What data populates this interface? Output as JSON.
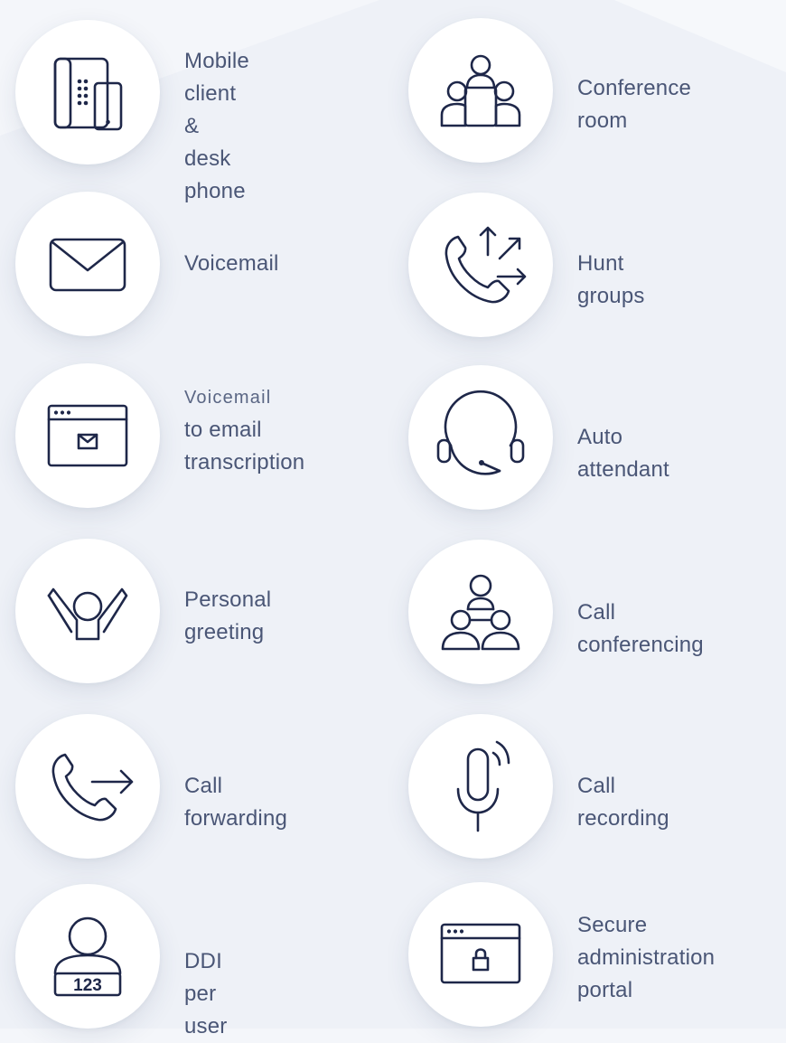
{
  "features": {
    "mobile_client": {
      "line1": "Mobile client",
      "line2": "& desk phone",
      "icon": "desk-phone-mobile-icon"
    },
    "conference_room": {
      "line1": "Conference room",
      "icon": "conference-room-icon"
    },
    "voicemail": {
      "line1": "Voicemail",
      "icon": "envelope-icon"
    },
    "hunt_groups": {
      "line1": "Hunt groups",
      "icon": "phone-arrows-icon"
    },
    "voicemail_email": {
      "line1": "Voicemail",
      "line2": "to email",
      "line3": "transcription",
      "icon": "browser-envelope-icon"
    },
    "auto_attendant": {
      "line1": "Auto attendant",
      "icon": "headset-icon"
    },
    "personal_greeting": {
      "line1": "Personal",
      "line2": "greeting",
      "icon": "person-waving-icon"
    },
    "call_conferencing": {
      "line1": "Call conferencing",
      "icon": "connected-people-icon"
    },
    "call_forwarding": {
      "line1": "Call forwarding",
      "icon": "phone-forward-icon"
    },
    "call_recording": {
      "line1": "Call recording",
      "icon": "microphone-icon"
    },
    "ddi_per_user": {
      "line1": "DDI per user",
      "badge": "123",
      "icon": "user-number-icon"
    },
    "secure_portal": {
      "line1": "Secure",
      "line2": "administration",
      "line3": "portal",
      "icon": "browser-lock-icon"
    }
  },
  "colors": {
    "icon_stroke": "#1e2749",
    "label_text": "#4a5676",
    "background": "#f4f6fa",
    "circle": "#ffffff"
  }
}
